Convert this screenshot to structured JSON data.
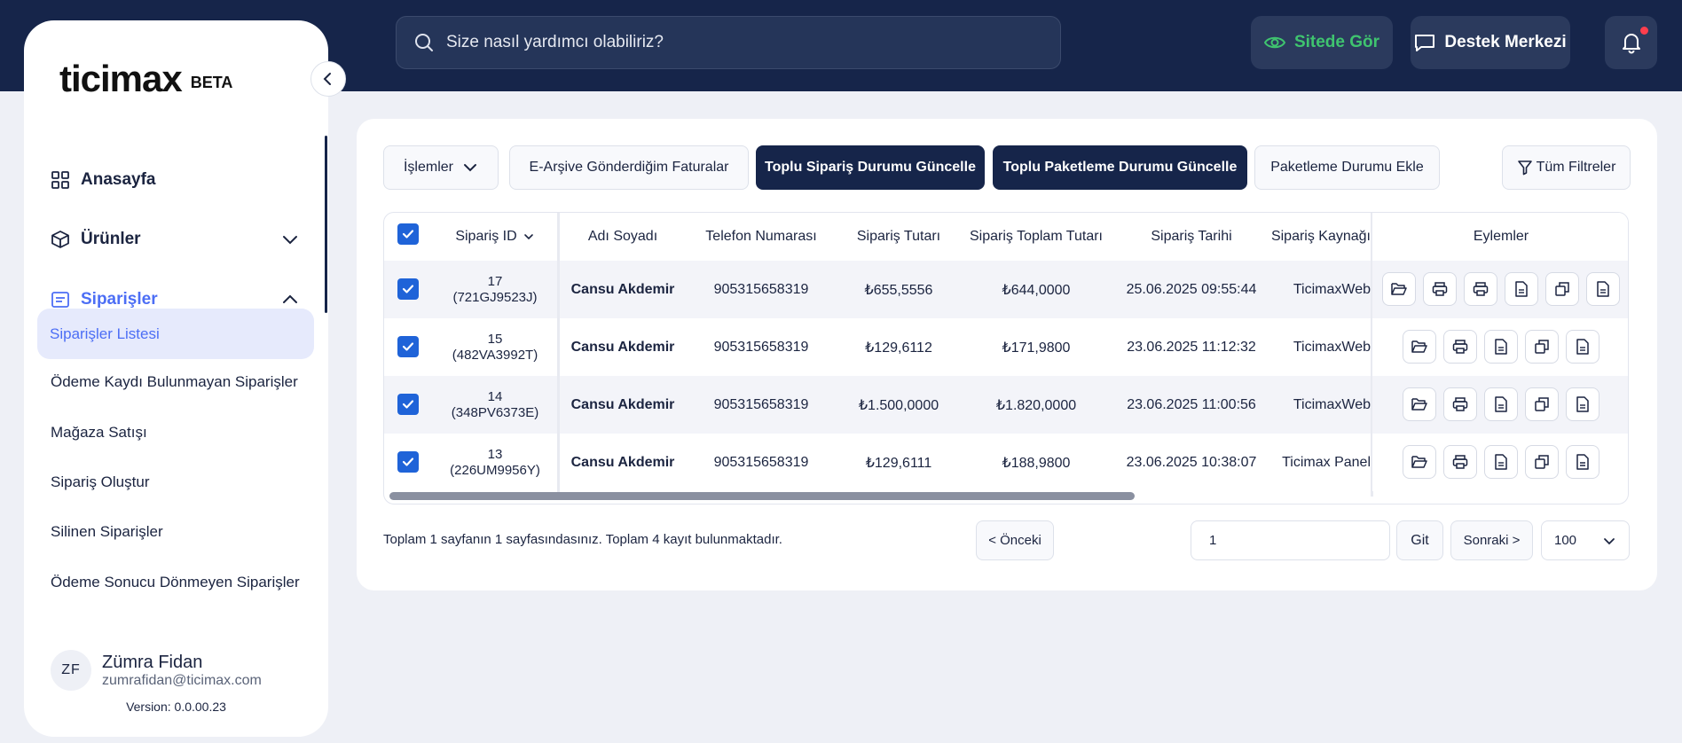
{
  "header": {
    "search_placeholder": "Size nasıl yardımcı olabiliriz?",
    "site_button": "Sitede Gör",
    "support_button": "Destek Merkezi"
  },
  "sidebar": {
    "logo": "ticimax",
    "logo_badge": "BETA",
    "nav": [
      {
        "label": "Anasayfa",
        "icon": "grid-icon"
      },
      {
        "label": "Ürünler",
        "icon": "box-icon"
      },
      {
        "label": "Siparişler",
        "icon": "orders-icon"
      }
    ],
    "sub_items": [
      "Siparişler Listesi",
      "Ödeme Kaydı Bulunmayan Siparişler",
      "Mağaza Satışı",
      "Sipariş Oluştur",
      "Silinen Siparişler",
      "Ödeme Sonucu Dönmeyen Siparişler"
    ],
    "user": {
      "initials": "ZF",
      "name": "Zümra Fidan",
      "email": "zumrafidan@ticimax.com"
    },
    "version": "Version: 0.0.00.23"
  },
  "toolbar": {
    "islemler": "İşlemler",
    "earsiv": "E-Arşive Gönderdiğim Faturalar",
    "toplu_siparis": "Toplu Sipariş Durumu Güncelle",
    "toplu_paketleme": "Toplu Paketleme Durumu Güncelle",
    "paketleme_ekle": "Paketleme Durumu Ekle",
    "tum_filtreler": "Tüm Filtreler"
  },
  "table": {
    "columns": [
      "Sipariş ID",
      "Adı Soyadı",
      "Telefon Numarası",
      "Sipariş Tutarı",
      "Sipariş Toplam Tutarı",
      "Sipariş Tarihi",
      "Sipariş Kaynağı",
      "Eylemler"
    ],
    "rows": [
      {
        "id": "17",
        "code": "(721GJ9523J)",
        "name": "Cansu Akdemir",
        "phone": "905315658319",
        "amount": "₺655,5556",
        "total": "₺644,0000",
        "date": "25.06.2025 09:55:44",
        "source": "TicimaxWeb",
        "actions": 6
      },
      {
        "id": "15",
        "code": "(482VA3992T)",
        "name": "Cansu Akdemir",
        "phone": "905315658319",
        "amount": "₺129,6112",
        "total": "₺171,9800",
        "date": "23.06.2025 11:12:32",
        "source": "TicimaxWeb",
        "actions": 5
      },
      {
        "id": "14",
        "code": "(348PV6373E)",
        "name": "Cansu Akdemir",
        "phone": "905315658319",
        "amount": "₺1.500,0000",
        "total": "₺1.820,0000",
        "date": "23.06.2025 11:00:56",
        "source": "TicimaxWeb",
        "actions": 5
      },
      {
        "id": "13",
        "code": "(226UM9956Y)",
        "name": "Cansu Akdemir",
        "phone": "905315658319",
        "amount": "₺129,6111",
        "total": "₺188,9800",
        "date": "23.06.2025 10:38:07",
        "source": "Ticimax Panel",
        "actions": 5
      }
    ]
  },
  "pagination": {
    "summary": "Toplam 1 sayfanın 1 sayfasındasınız. Toplam 4 kayıt bulunmaktadır.",
    "prev": "< Önceki",
    "page": "1",
    "go": "Git",
    "next": "Sonraki >",
    "page_size": "100"
  }
}
